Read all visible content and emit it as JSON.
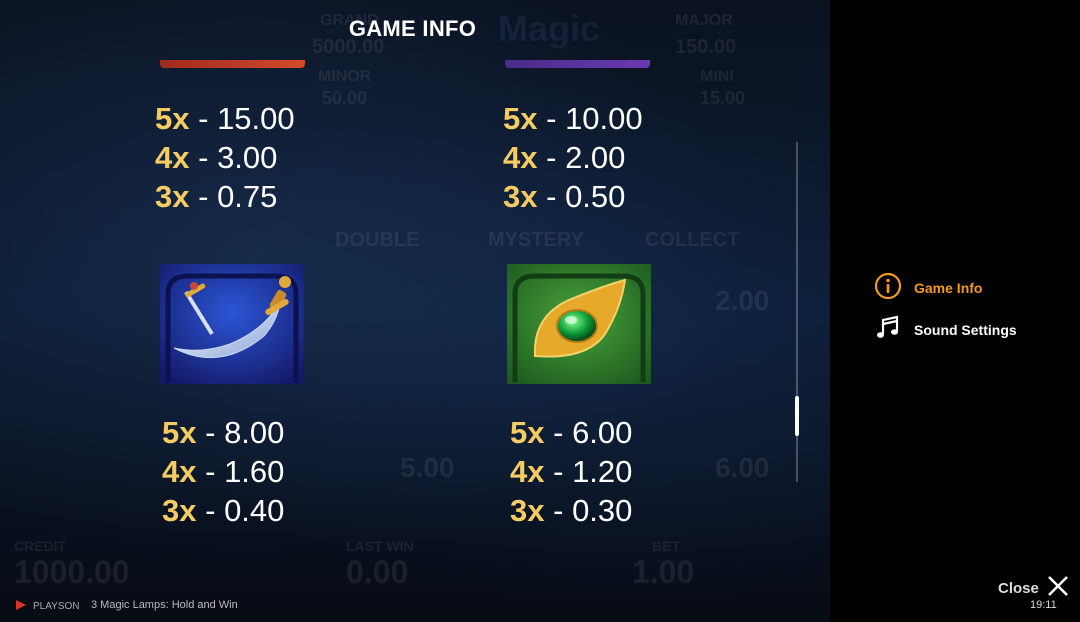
{
  "header": {
    "title": "GAME INFO"
  },
  "pay_groups": [
    {
      "icon": null,
      "pays": [
        {
          "mult": "5x",
          "sep": "-",
          "value": "15.00"
        },
        {
          "mult": "4x",
          "sep": "-",
          "value": "3.00"
        },
        {
          "mult": "3x",
          "sep": "-",
          "value": "0.75"
        }
      ]
    },
    {
      "icon": null,
      "pays": [
        {
          "mult": "5x",
          "sep": "-",
          "value": "10.00"
        },
        {
          "mult": "4x",
          "sep": "-",
          "value": "2.00"
        },
        {
          "mult": "3x",
          "sep": "-",
          "value": "0.50"
        }
      ]
    },
    {
      "icon": "scimitar-symbol-icon",
      "pays": [
        {
          "mult": "5x",
          "sep": "-",
          "value": "8.00"
        },
        {
          "mult": "4x",
          "sep": "-",
          "value": "1.60"
        },
        {
          "mult": "3x",
          "sep": "-",
          "value": "0.40"
        }
      ]
    },
    {
      "icon": "emerald-brooch-symbol-icon",
      "pays": [
        {
          "mult": "5x",
          "sep": "-",
          "value": "6.00"
        },
        {
          "mult": "4x",
          "sep": "-",
          "value": "1.20"
        },
        {
          "mult": "3x",
          "sep": "-",
          "value": "0.30"
        }
      ]
    }
  ],
  "menu": [
    {
      "label": "Game Info",
      "icon": "info-icon",
      "active": true
    },
    {
      "label": "Sound Settings",
      "icon": "music-note-icon",
      "active": false
    }
  ],
  "close": {
    "label": "Close",
    "icon": "close-icon"
  },
  "footer": {
    "brand": "PLAYSON",
    "game_title": "3 Magic Lamps: Hold and Win",
    "time": "19:11"
  },
  "background_game": {
    "jackpots": [
      "GRAND",
      "5000.00",
      "MAJOR",
      "150.00",
      "MINOR",
      "50.00",
      "MINI",
      "15.00"
    ],
    "logo": "Magic",
    "features": [
      "DOUBLE",
      "MYSTERY",
      "COLLECT"
    ],
    "coins": [
      "2.00",
      "5.00",
      "6.00"
    ],
    "bottom": [
      "CREDIT",
      "1000.00",
      "LAST WIN",
      "0.00",
      "BET",
      "1.00"
    ]
  },
  "colors": {
    "accent": "#f29a1e",
    "multiplier": "#f4cc62"
  }
}
